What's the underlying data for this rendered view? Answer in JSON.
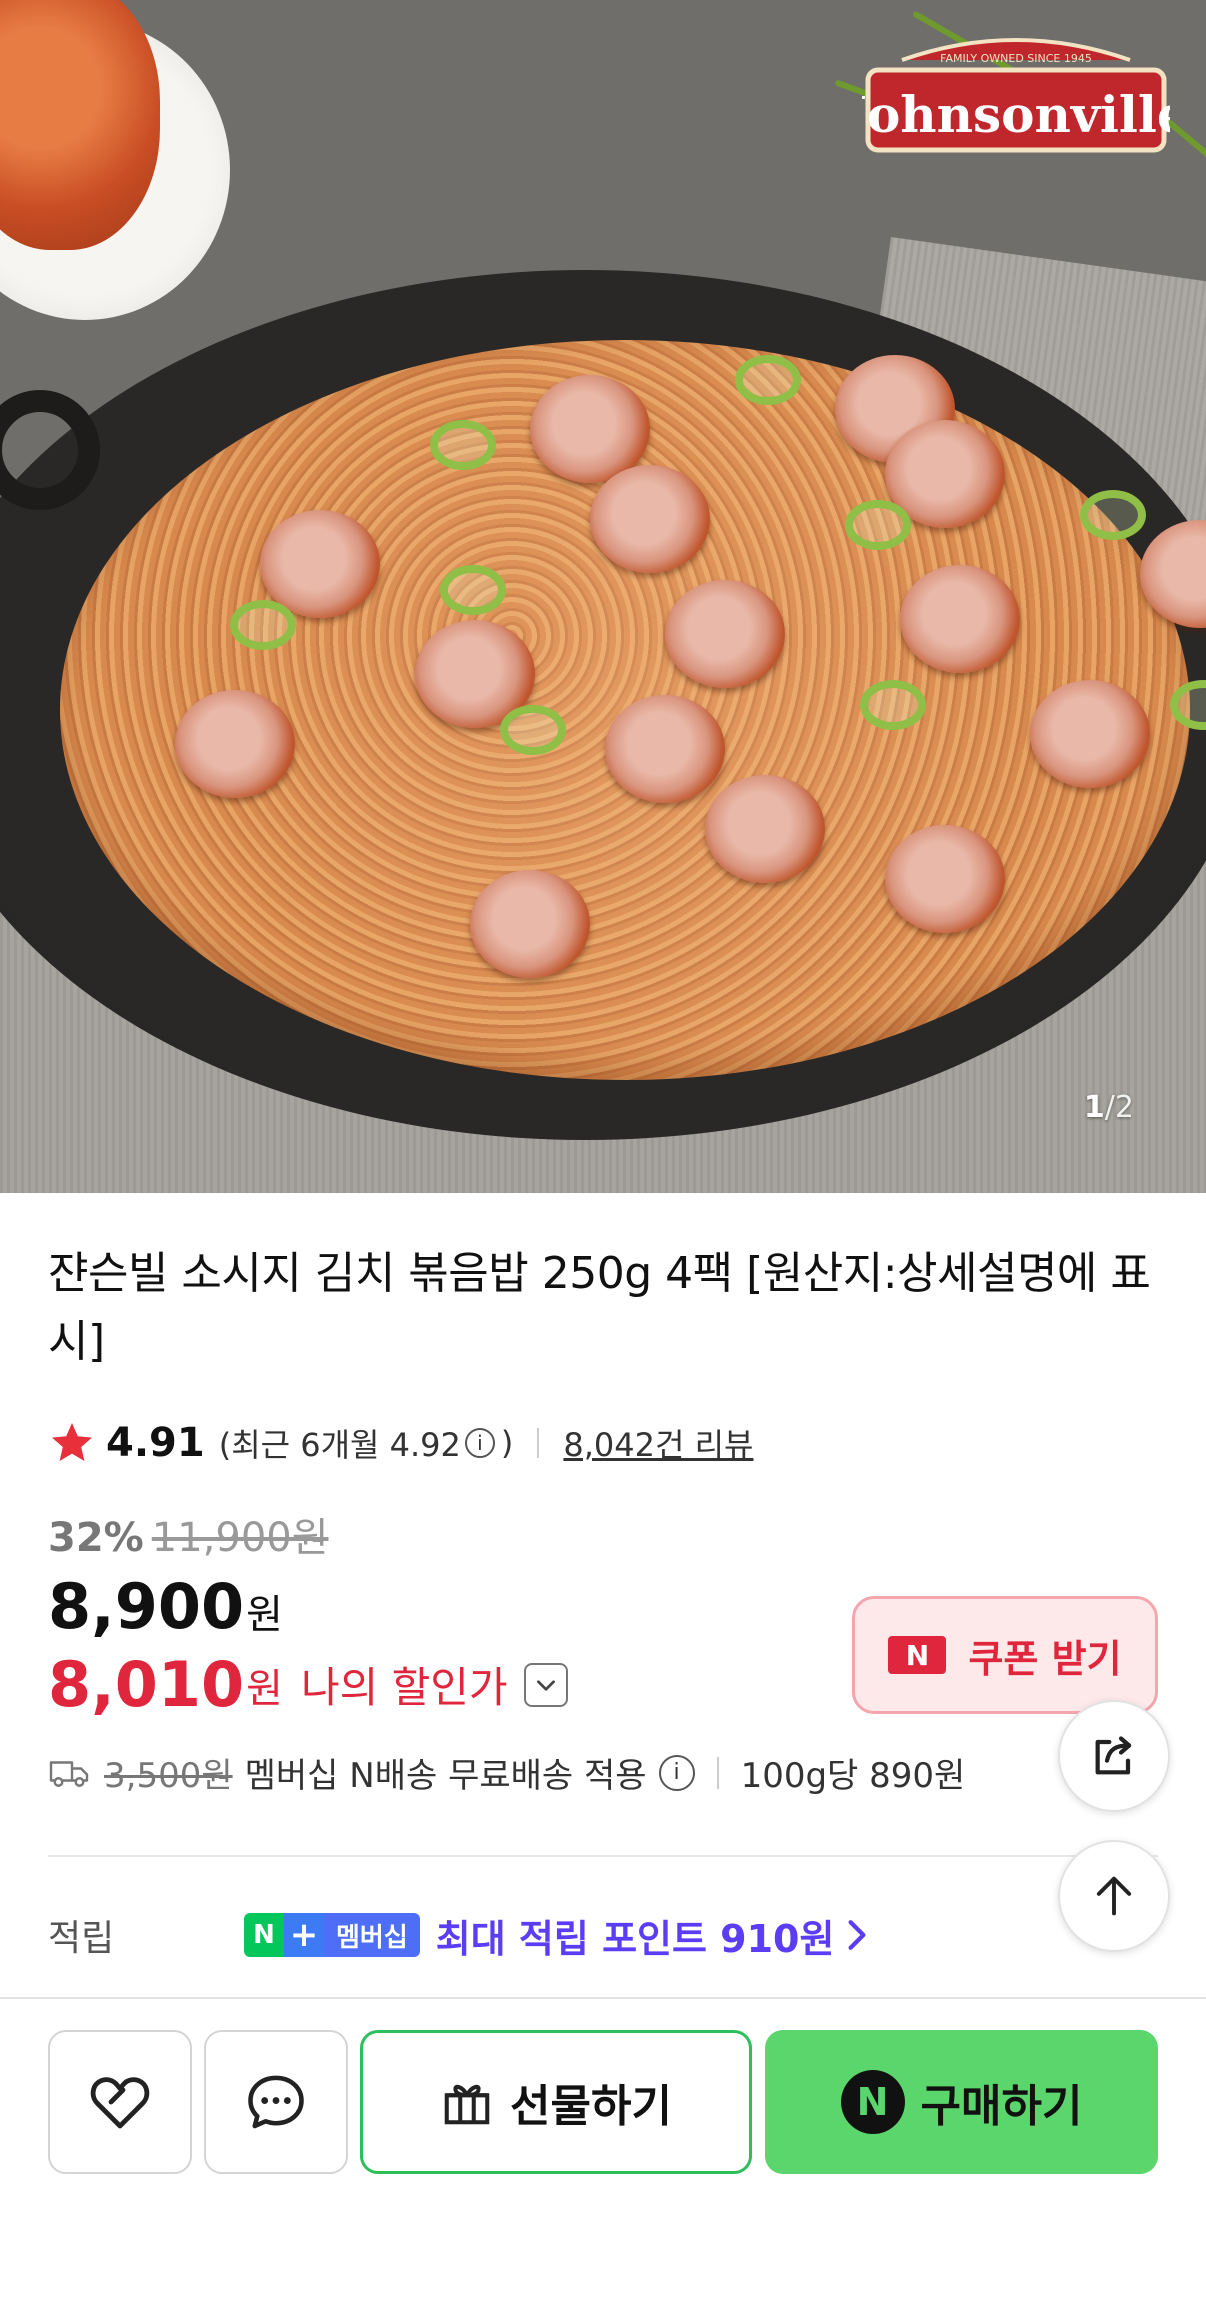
{
  "hero": {
    "brand_logo_text": "Johnsonville",
    "brand_logo_tagline": "FAMILY OWNED SINCE 1945",
    "image_counter_current": "1",
    "image_counter_sep": "/",
    "image_counter_total": "2"
  },
  "product": {
    "title": "쟌슨빌 소시지 김치 볶음밥 250g 4팩 [원산지:상세설명에 표시]",
    "rating": "4.91",
    "recent_rating_text": "(최근 6개월 4.92",
    "recent_rating_close": ")",
    "info_icon_glyph": "i",
    "reviews": "8,042건 리뷰"
  },
  "price": {
    "discount_rate": "32%",
    "original_price": "11,900원",
    "sale_price": "8,900",
    "won": "원",
    "my_price": "8,010",
    "my_price_label": "나의 할인가",
    "coupon_badge": "N",
    "coupon_label": "쿠폰 받기"
  },
  "shipping": {
    "original_fee": "3,500원",
    "text": "멤버십 N배송 무료배송 적용",
    "unit_price": "100g당 890원"
  },
  "points": {
    "label": "적립",
    "badge_n": "N",
    "badge_plus": "+",
    "badge_member": "멤버십",
    "text": "최대 적립 포인트 910원"
  },
  "bottom_bar": {
    "gift_label": "선물하기",
    "buy_label": "구매하기",
    "buy_badge": "N"
  },
  "colors": {
    "accent_red": "#e0263c",
    "naver_green": "#5ad66c",
    "member_purple": "#5b3df5"
  }
}
